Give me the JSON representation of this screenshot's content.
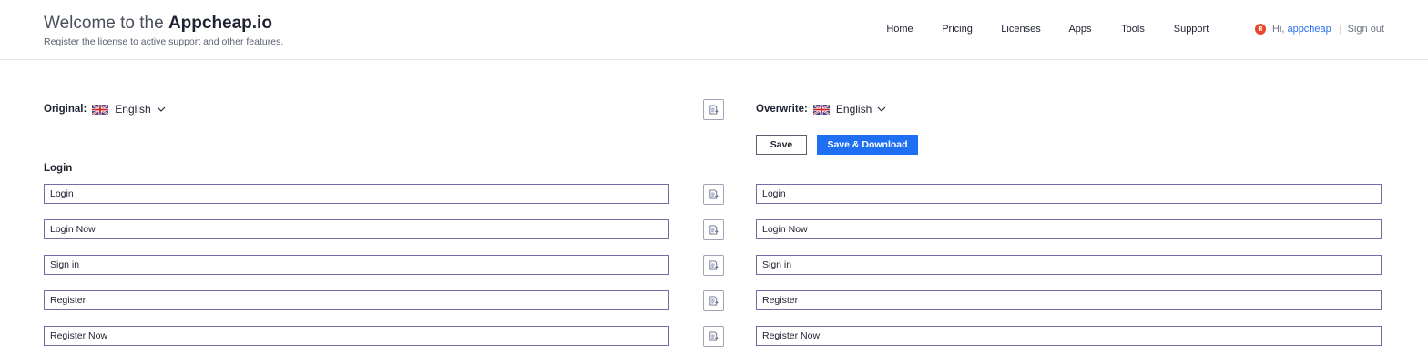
{
  "header": {
    "welcome_text": "Welcome to the",
    "brand_name": "Appcheap.io",
    "subtitle": "Register the license to active support and other features."
  },
  "nav": {
    "items": [
      {
        "label": "Home"
      },
      {
        "label": "Pricing"
      },
      {
        "label": "Licenses"
      },
      {
        "label": "Apps"
      },
      {
        "label": "Tools"
      },
      {
        "label": "Support"
      }
    ]
  },
  "user": {
    "avatar_letter": "R",
    "greeting": "Hi,",
    "username": "appcheap",
    "separator": "|",
    "sign_out": "Sign out"
  },
  "original": {
    "label": "Original:",
    "language": "English",
    "flag_icon": "uk-flag-icon"
  },
  "overwrite": {
    "label": "Overwrite:",
    "language": "English",
    "flag_icon": "uk-flag-icon"
  },
  "actions": {
    "save_label": "Save",
    "save_download_label": "Save & Download",
    "copy_icon": "copy-to-right-icon"
  },
  "section": {
    "title": "Login",
    "rows": [
      {
        "original": "Login",
        "overwrite": "Login"
      },
      {
        "original": "Login Now",
        "overwrite": "Login Now"
      },
      {
        "original": "Sign in",
        "overwrite": "Sign in"
      },
      {
        "original": "Register",
        "overwrite": "Register"
      },
      {
        "original": "Register Now",
        "overwrite": "Register Now"
      }
    ]
  },
  "colors": {
    "primary": "#1f6ff2",
    "link": "#2a6ef2",
    "avatar": "#e8462a",
    "field_border": "#6e6fa8"
  }
}
